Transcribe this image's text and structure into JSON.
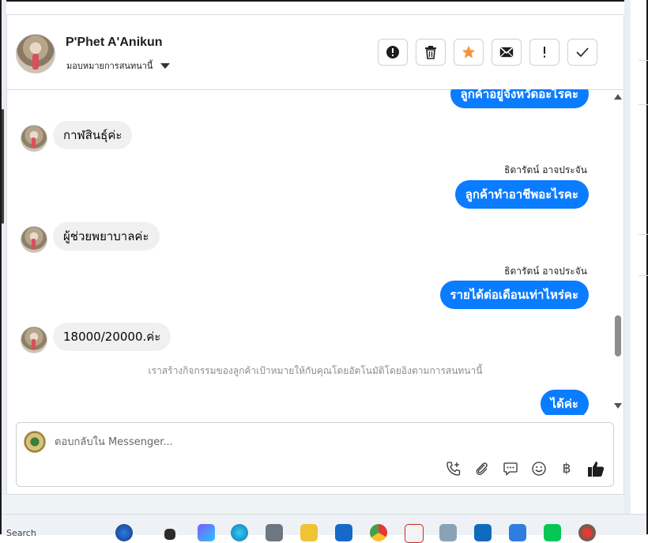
{
  "contact": {
    "name": "P'Phet A'Anikun",
    "assign_label": "มอบหมายการสนทนานี้"
  },
  "toolbar": {
    "buttons": [
      "alert-icon",
      "trash-icon",
      "star-icon",
      "envelope-icon",
      "exclamation-icon",
      "check-icon"
    ],
    "star_color": "#f7923b"
  },
  "messages": [
    {
      "dir": "out",
      "text": "ลูกค้าอยู่จังหวัดอะไรคะ"
    },
    {
      "dir": "in",
      "text": "กาฬสินธุ์ค่ะ"
    },
    {
      "dir": "out",
      "sender": "ธิดารัตน์ อาจประจัน",
      "text": "ลูกค้าทำอาชีพอะไรคะ"
    },
    {
      "dir": "in",
      "text": "ผู้ช่วยพยาบาลค่ะ"
    },
    {
      "dir": "out",
      "sender": "ธิดารัตน์ อาจประจัน",
      "text": "รายได้ต่อเดือนเท่าไหร่คะ"
    },
    {
      "dir": "in",
      "text": "18000/20000.ค่ะ"
    },
    {
      "dir": "out",
      "text": "ได้ค่ะ"
    }
  ],
  "system_note": "เราสร้างกิจกรรมของลูกค้าเป้าหมายให้กับคุณโดยอัตโนมัติโดยอิงตามการสนทนานี้",
  "composer": {
    "placeholder": "ตอบกลับใน Messenger...",
    "icons": [
      "phone-plus-icon",
      "paperclip-icon",
      "chat-bubble-icon",
      "smiley-icon",
      "baht-icon",
      "thumbs-up-icon"
    ],
    "baht_symbol": "฿"
  },
  "colors": {
    "outgoing_bubble": "#0a7cff",
    "incoming_bubble": "#f0f0f0",
    "system_text": "#8a8d91"
  },
  "taskbar": {
    "search_text": "Search"
  }
}
